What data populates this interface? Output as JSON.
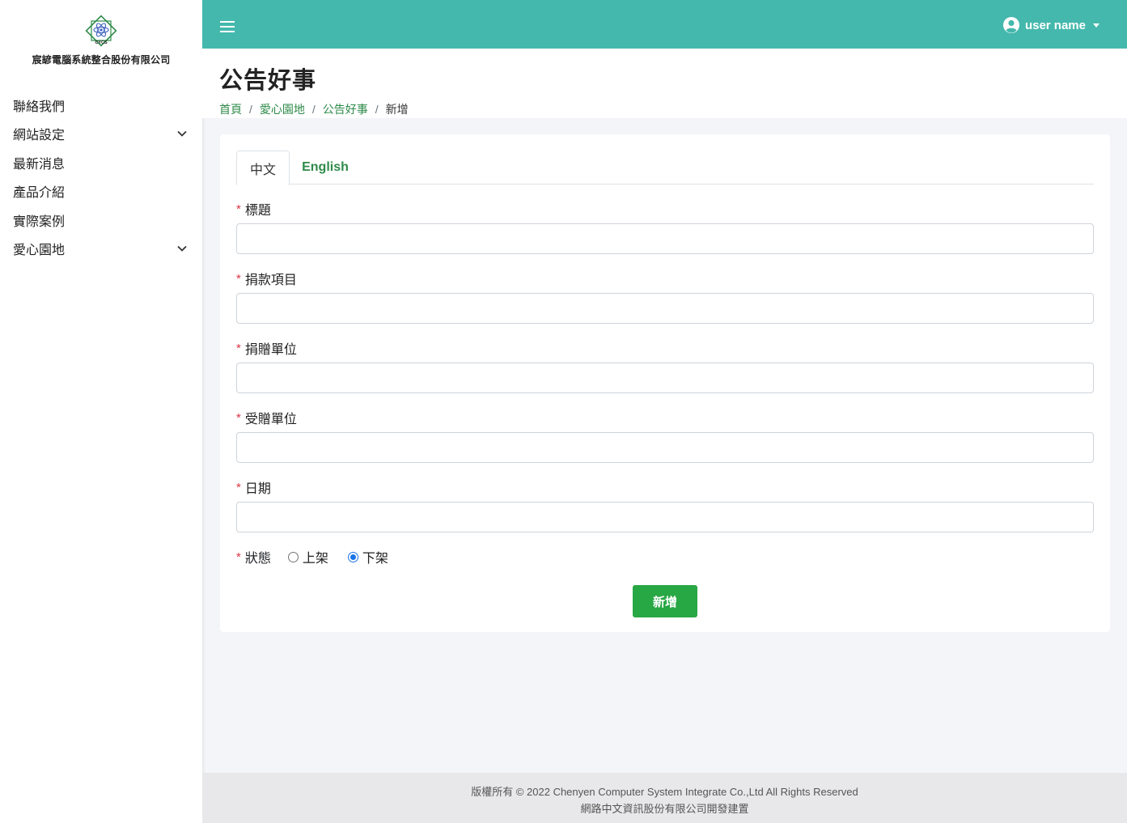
{
  "brand": {
    "company_name": "宸諺電腦系統整合股份有限公司",
    "logo_text": "CYCS"
  },
  "sidebar": {
    "items": [
      {
        "label": "聯絡我們",
        "has_submenu": false
      },
      {
        "label": "網站設定",
        "has_submenu": true
      },
      {
        "label": "最新消息",
        "has_submenu": false
      },
      {
        "label": "產品介紹",
        "has_submenu": false
      },
      {
        "label": "實際案例",
        "has_submenu": false
      },
      {
        "label": "愛心園地",
        "has_submenu": true
      }
    ]
  },
  "topbar": {
    "user_name": "user name",
    "accent_color": "#45b8ad"
  },
  "page": {
    "title": "公告好事",
    "breadcrumb": {
      "home": "首頁",
      "section": "愛心園地",
      "page": "公告好事",
      "current": "新增"
    }
  },
  "tabs": {
    "chinese": "中文",
    "english": "English",
    "active": "中文"
  },
  "form": {
    "required_mark": "*",
    "fields": [
      {
        "label": "標題",
        "value": ""
      },
      {
        "label": "捐款項目",
        "value": ""
      },
      {
        "label": "捐贈單位",
        "value": ""
      },
      {
        "label": "受贈單位",
        "value": ""
      },
      {
        "label": "日期",
        "value": ""
      }
    ],
    "status": {
      "label": "狀態",
      "options": [
        "上架",
        "下架"
      ],
      "selected": "下架"
    },
    "submit_label": "新增"
  },
  "footer": {
    "copyright": "版權所有 © 2022 Chenyen Computer System Integrate Co.,Ltd All Rights Reserved",
    "credit": "網路中文資訊股份有限公司開發建置"
  }
}
